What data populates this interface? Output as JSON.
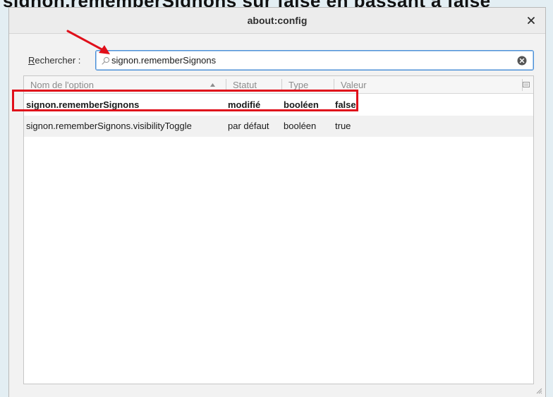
{
  "banner": {
    "text": "signon.rememberSignons sur false en passant à false"
  },
  "window": {
    "title": "about:config"
  },
  "search": {
    "label_underlined": "R",
    "label_rest": "echercher :",
    "value": "signon.rememberSignons"
  },
  "table": {
    "columns": [
      {
        "label": "Nom de l'option"
      },
      {
        "label": "Statut"
      },
      {
        "label": "Type"
      },
      {
        "label": "Valeur"
      }
    ],
    "rows": [
      {
        "name": "signon.rememberSignons",
        "status": "modifié",
        "type": "booléen",
        "value": "false"
      },
      {
        "name": "signon.rememberSignons.visibilityToggle",
        "status": "par défaut",
        "type": "booléen",
        "value": "true"
      }
    ]
  },
  "colors": {
    "highlight": "#e0101b",
    "arrow": "#e0101b",
    "focus": "#4a90d9"
  },
  "icons": [
    "close-icon",
    "search-icon",
    "clear-icon",
    "sort-ascending-icon",
    "column-picker-icon",
    "arrow-annotation",
    "resize-grip-icon"
  ]
}
